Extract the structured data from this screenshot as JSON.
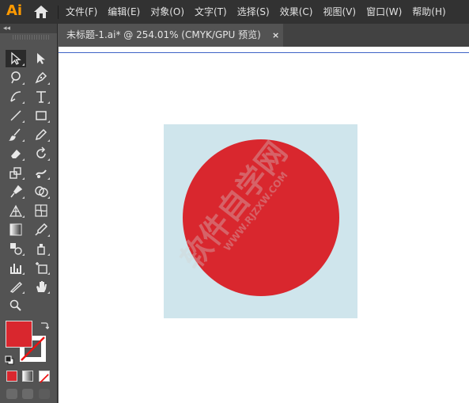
{
  "app": {
    "logo": "Ai"
  },
  "menu": [
    "文件(F)",
    "编辑(E)",
    "对象(O)",
    "文字(T)",
    "选择(S)",
    "效果(C)",
    "视图(V)",
    "窗口(W)",
    "帮助(H)"
  ],
  "panel": {
    "collapse_glyph": "◂◂"
  },
  "document": {
    "tab_title": "未标题-1.ai* @ 254.01% (CMYK/GPU 预览)",
    "close_glyph": "×"
  },
  "artwork": {
    "artboard_color": "#cfe5ec",
    "circle_color": "#d9272e"
  },
  "watermark": {
    "text": "软件自学网",
    "url": "WWW.RJZXW.COM"
  },
  "colors": {
    "fill": "#d9272e",
    "accent": "#ff9a00",
    "selection_line": "#3d63c6"
  }
}
